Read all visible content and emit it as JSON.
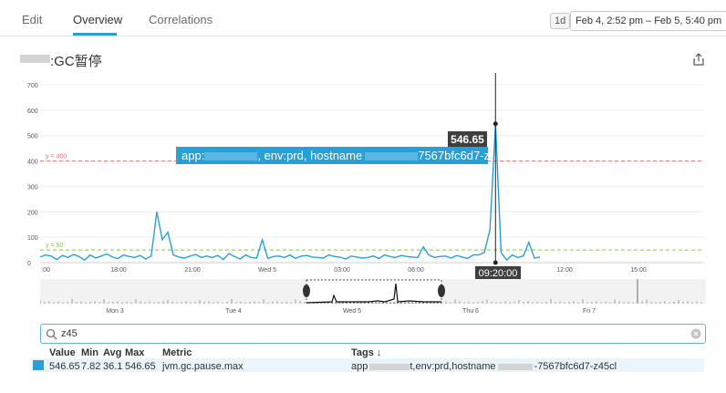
{
  "tabs": [
    {
      "label": "Edit",
      "active": false
    },
    {
      "label": "Overview",
      "active": true
    },
    {
      "label": "Correlations",
      "active": false
    }
  ],
  "time_range": {
    "badge": "1d",
    "value": "Feb 4, 2:52 pm – Feb 5, 5:40 pm"
  },
  "graph": {
    "title": ":GC暂停",
    "share_icon": "share-icon"
  },
  "chart_data": {
    "type": "line",
    "y_ticks": [
      "0",
      "100",
      "200",
      "300",
      "400",
      "500",
      "600",
      "700"
    ],
    "x_ticks": [
      ":00",
      "18:00",
      "21:00",
      "Wed 5",
      "03:00",
      "06:00",
      "12:00",
      "15:00"
    ],
    "ylim": [
      0,
      700
    ],
    "markers": [
      {
        "label": "y = 400",
        "value": 400,
        "color": "#e57373"
      },
      {
        "label": "y = 50",
        "value": 50,
        "color": "#8bc34a"
      }
    ],
    "series": [
      {
        "name": "jvm.gc.pause.max",
        "color": "#2a9fd6",
        "values": [
          22,
          30,
          26,
          12,
          28,
          20,
          32,
          24,
          10,
          30,
          18,
          26,
          34,
          22,
          16,
          30,
          24,
          20,
          28,
          14,
          26,
          200,
          90,
          120,
          30,
          22,
          18,
          26,
          32,
          20,
          26,
          20,
          28,
          12,
          36,
          24,
          14,
          30,
          20,
          18,
          90,
          16,
          24,
          26,
          20,
          30,
          16,
          26,
          28,
          22,
          20,
          18,
          30,
          24,
          22,
          14,
          26,
          22,
          18,
          20,
          26,
          16,
          30,
          24,
          20,
          28,
          24,
          22,
          20,
          62,
          30,
          20,
          24,
          26,
          18,
          28,
          22,
          16,
          30,
          30,
          40,
          130,
          546.65,
          40,
          10,
          30,
          20,
          26,
          80,
          18,
          22
        ]
      }
    ],
    "highlight": {
      "value": "546.65",
      "time": "09:20:00"
    },
    "navigator_ticks": [
      "Mon 3",
      "Tue 4",
      "Wed 5",
      "Thu 6",
      "Fri 7"
    ]
  },
  "series_tooltip": {
    "prefix": "app:",
    "mid": ", env:prd, hostname",
    "suffix": "7567bfc6d7-z45cl"
  },
  "search": {
    "value": "z45",
    "placeholder": ""
  },
  "legend": {
    "headers": {
      "value": "Value",
      "min": "Min",
      "avg": "Avg",
      "max": "Max",
      "metric": "Metric",
      "tags": "Tags ↓"
    },
    "rows": [
      {
        "value": "546.65",
        "min": "7.82",
        "avg": "36.1",
        "max": "546.65",
        "metric": "jvm.gc.pause.max",
        "tags_prefix": "app",
        "tags_mid": "t,env:prd,hostname",
        "tags_suffix": "-7567bfc6d7-z45cl",
        "color": "#2a9fd6"
      }
    ]
  }
}
